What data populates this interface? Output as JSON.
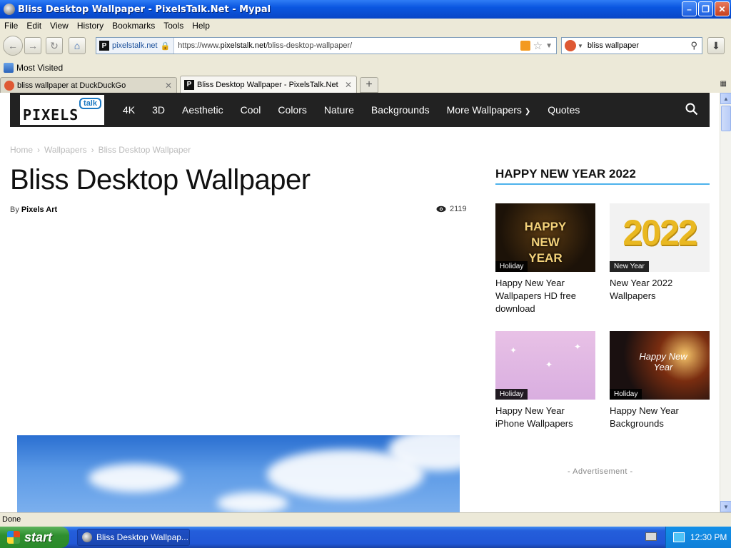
{
  "window": {
    "title": "Bliss Desktop Wallpaper - PixelsTalk.Net - Mypal"
  },
  "menu": [
    "File",
    "Edit",
    "View",
    "History",
    "Bookmarks",
    "Tools",
    "Help"
  ],
  "address": {
    "site": "pixelstalk.net",
    "url_prefix": "https://www.",
    "url_domain": "pixelstalk.net",
    "url_path": "/bliss-desktop-wallpaper/"
  },
  "search": {
    "query": "bliss wallpaper"
  },
  "bookmarks": {
    "most_visited": "Most Visited"
  },
  "tabs": [
    {
      "label": "bliss wallpaper at DuckDuckGo",
      "active": false
    },
    {
      "label": "Bliss Desktop Wallpaper - PixelsTalk.Net",
      "active": true
    }
  ],
  "site": {
    "logo_main": "PIXELS",
    "logo_talk": "talk",
    "nav": [
      "4K",
      "3D",
      "Aesthetic",
      "Cool",
      "Colors",
      "Nature",
      "Backgrounds",
      "More Wallpapers",
      "Quotes"
    ]
  },
  "breadcrumb": [
    "Home",
    "Wallpapers",
    "Bliss Desktop Wallpaper"
  ],
  "article": {
    "title": "Bliss Desktop Wallpaper",
    "by": "By",
    "author": "Pixels Art",
    "views": "2119"
  },
  "sidebar": {
    "title": "HAPPY NEW YEAR 2022",
    "cards": [
      {
        "category": "Holiday",
        "title": "Happy New Year Wallpapers HD free download",
        "thumb_text": "HAPPY NEW YEAR"
      },
      {
        "category": "New Year",
        "title": "New Year 2022 Wallpapers",
        "thumb_text": "2022"
      },
      {
        "category": "Holiday",
        "title": "Happy New Year iPhone Wallpapers",
        "thumb_text": ""
      },
      {
        "category": "Holiday",
        "title": "Happy New Year Backgrounds",
        "thumb_text": "Happy New Year"
      }
    ],
    "advertisement": "- Advertisement -"
  },
  "status": {
    "text": "Done"
  },
  "taskbar": {
    "start": "start",
    "item": "Bliss Desktop Wallpap...",
    "clock": "12:30 PM"
  }
}
